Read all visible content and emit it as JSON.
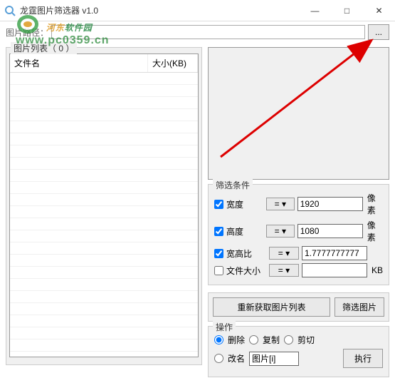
{
  "window": {
    "title": "龙霆图片筛选器 v1.0",
    "minimize": "—",
    "maximize": "□",
    "close": "✕"
  },
  "path": {
    "label": "图片路径：",
    "value": "",
    "browse": "..."
  },
  "list": {
    "group_title": "图片列表（ 0 ）",
    "col_name": "文件名",
    "col_size": "大小(KB)"
  },
  "filter": {
    "title": "筛选条件",
    "width_label": "宽度",
    "width_checked": true,
    "width_op": "= ▾",
    "width_val": "1920",
    "width_unit": "像素",
    "height_label": "高度",
    "height_checked": true,
    "height_op": "= ▾",
    "height_val": "1080",
    "height_unit": "像素",
    "ratio_label": "宽高比",
    "ratio_checked": true,
    "ratio_op": "= ▾",
    "ratio_val": "1.7777777777",
    "size_label": "文件大小",
    "size_checked": false,
    "size_op": "= ▾",
    "size_val": "",
    "size_unit": "KB"
  },
  "buttons": {
    "refresh": "重新获取图片列表",
    "filter": "筛选图片",
    "execute": "执行"
  },
  "operation": {
    "title": "操作",
    "delete": "删除",
    "copy": "复制",
    "cut": "剪切",
    "rename": "改名",
    "rename_pattern": "图片[i]"
  },
  "watermark": {
    "brand_part1": "河东",
    "brand_part2": "软件园",
    "url": "www.pc0359.cn"
  }
}
